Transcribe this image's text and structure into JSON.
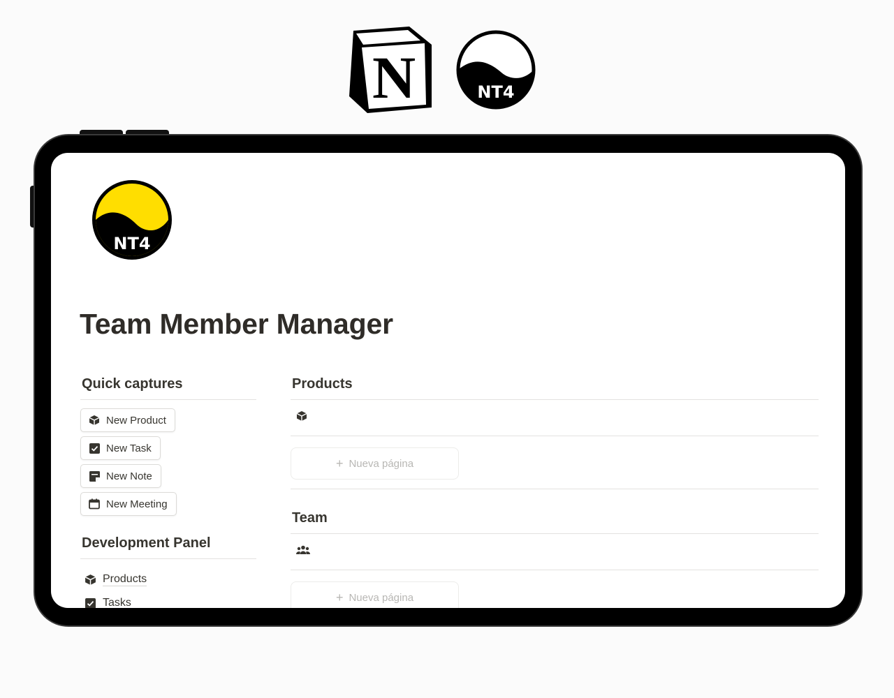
{
  "page": {
    "title": "Team Member Manager"
  },
  "brand": {
    "notion_logo_letter": "N",
    "nt4_logo_text": "NT4",
    "accent_yellow": "#ffde00"
  },
  "quick_captures": {
    "heading": "Quick captures",
    "buttons": [
      {
        "label": "New Product",
        "icon": "package-icon"
      },
      {
        "label": "New Task",
        "icon": "checkbox-icon"
      },
      {
        "label": "New Note",
        "icon": "note-icon"
      },
      {
        "label": "New Meeting",
        "icon": "calendar-icon"
      }
    ]
  },
  "development_panel": {
    "heading": "Development Panel",
    "items": [
      {
        "label": "Products",
        "icon": "package-icon"
      },
      {
        "label": "Tasks",
        "icon": "checkbox-icon"
      }
    ]
  },
  "databases": [
    {
      "heading": "Products",
      "row_icon": "package-icon",
      "new_page_label": "Nueva página"
    },
    {
      "heading": "Team",
      "row_icon": "people-icon",
      "new_page_label": "Nueva página"
    }
  ]
}
